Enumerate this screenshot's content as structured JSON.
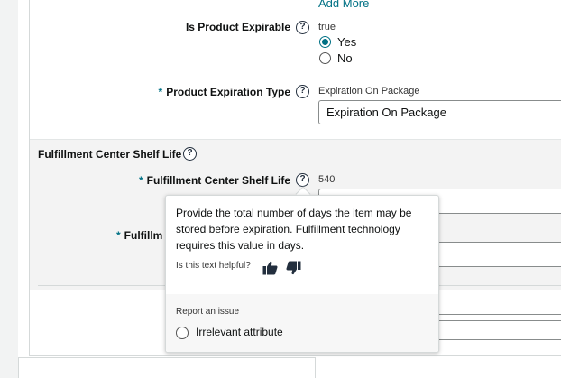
{
  "add_more": {
    "label": "Add More"
  },
  "expirable": {
    "label": "Is Product Expirable",
    "current_value": "true",
    "options": [
      {
        "label": "Yes",
        "checked": true
      },
      {
        "label": "No",
        "checked": false
      }
    ]
  },
  "expiration_type": {
    "required_mark": "*",
    "label": "Product Expiration Type",
    "current_value": "Expiration On Package",
    "input_value": "Expiration On Package"
  },
  "shelf_life_section": {
    "title": "Fulfillment Center Shelf Life",
    "field": {
      "required_mark": "*",
      "label": "Fulfillment Center Shelf Life",
      "current_value": "540"
    },
    "second_field": {
      "required_mark": "*",
      "label_visible": "Fulfillm"
    }
  },
  "popover": {
    "text": "Provide the total number of days the item may be stored before expiration. Fulfillment technology requires this value in days.",
    "helpful_prompt": "Is this text helpful?",
    "report_title": "Report an issue",
    "report_option": "Irrelevant attribute"
  },
  "icons": {
    "help": "question-circle-icon",
    "thumbs_up": "thumbs-up-icon",
    "thumbs_down": "thumbs-down-icon"
  },
  "colors": {
    "accent": "#007185",
    "section_background": "#f3f3f3",
    "text": "#0f1111"
  }
}
